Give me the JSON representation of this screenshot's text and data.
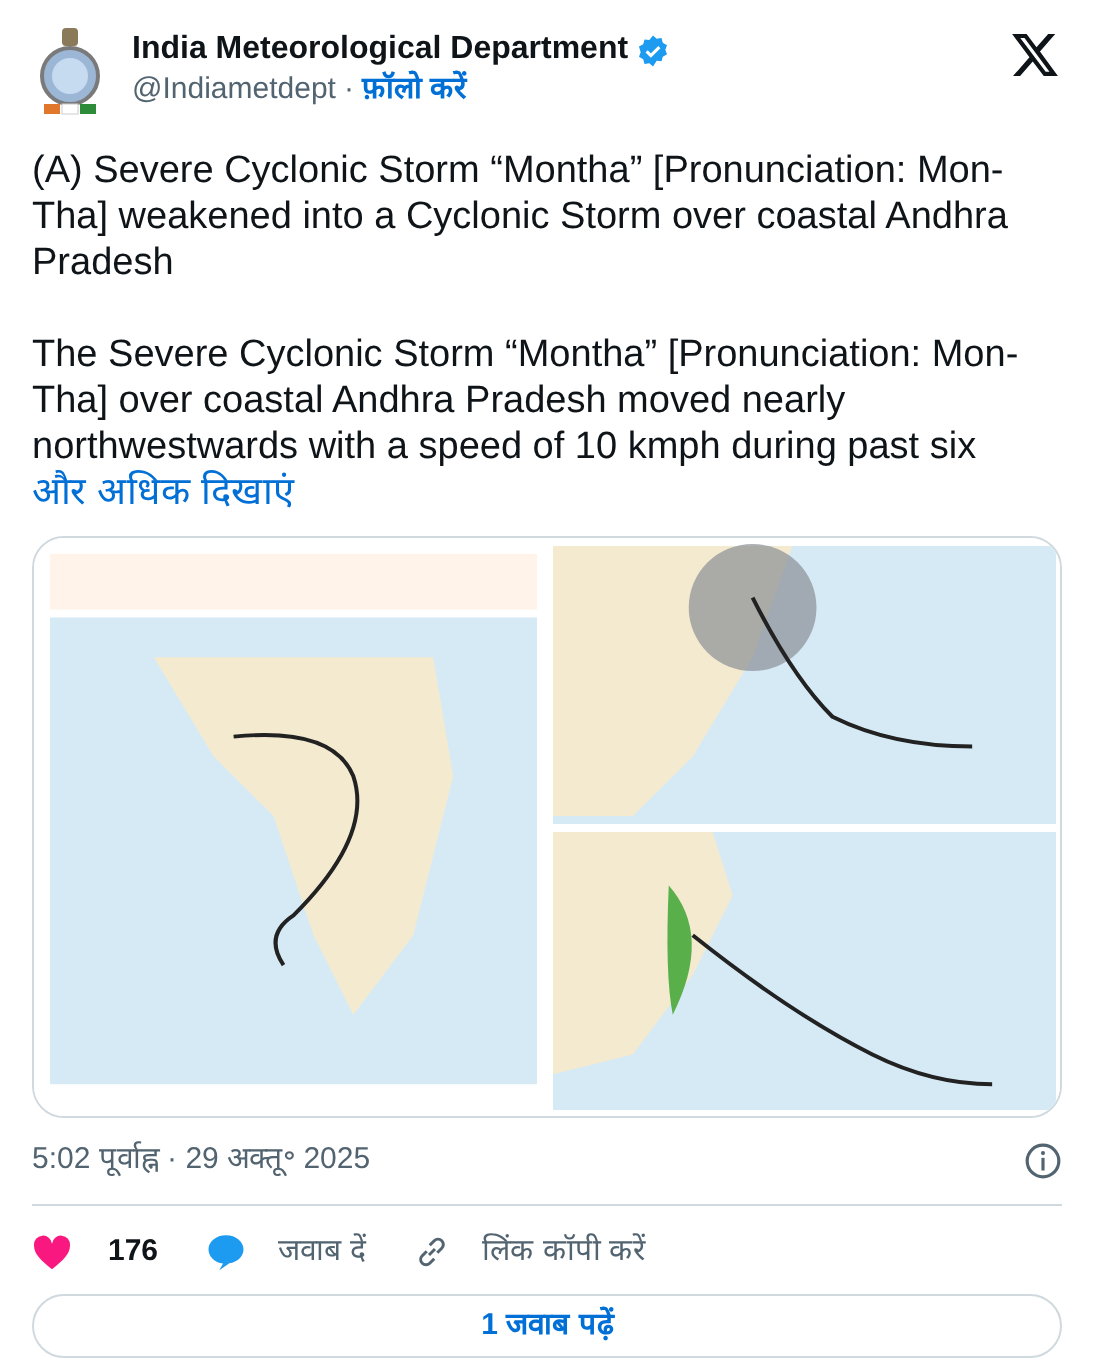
{
  "author": {
    "name": "India Meteorological Department",
    "verified": true,
    "handle": "@Indiametdept",
    "separator": "·",
    "follow": "फ़ॉलो करें"
  },
  "paragraphs": [
    "(A) Severe Cyclonic Storm “Montha” [Pronunciation: Mon-Tha] weakened into a Cyclonic Storm over coastal Andhra Pradesh",
    "The Severe Cyclonic Storm “Montha” [Pronunciation: Mon-Tha] over coastal Andhra Pradesh moved nearly northwestwards with a speed of 10 kmph during past six"
  ],
  "show_more": "और अधिक दिखाएं",
  "media": {
    "kind": "picture"
  },
  "timestamp": "5:02 पूर्वाह्न · 29 अक्तू॰ 2025",
  "actions": [
    {
      "kind": "like",
      "label": "176"
    },
    {
      "kind": "reply",
      "label": "जवाब दें"
    },
    {
      "kind": "copy",
      "label": "लिंक कॉपी करें"
    }
  ],
  "read_replies": "1 जवाब पढ़ें"
}
